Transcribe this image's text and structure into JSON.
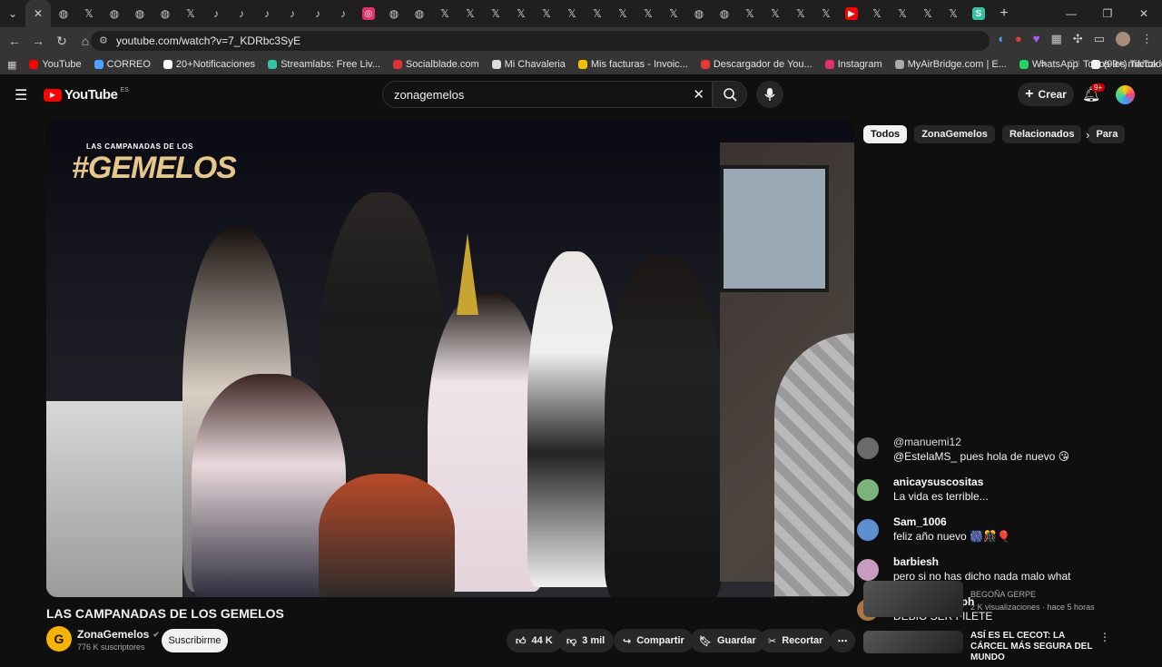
{
  "browser": {
    "url": "youtube.com/watch?v=7_KDRbc3SyE",
    "bookmarks": [
      {
        "label": "YouTube",
        "icon": "youtube-icon",
        "color": "#ff0000"
      },
      {
        "label": "CORREO",
        "icon": "mail-icon",
        "color": "#4aa3ff"
      },
      {
        "label": "20+Notificaciones",
        "icon": "x-icon",
        "color": "#ffffff"
      },
      {
        "label": "Streamlabs: Free Liv...",
        "icon": "streamlabs-icon",
        "color": "#31c3a2"
      },
      {
        "label": "Socialblade.com",
        "icon": "socialblade-icon",
        "color": "#d33"
      },
      {
        "label": "Mi Chavaleria",
        "icon": "chavaleria-icon",
        "color": "#ddd"
      },
      {
        "label": "Mis facturas - Invoic...",
        "icon": "invoice-icon",
        "color": "#f5c000"
      },
      {
        "label": "Descargador de You...",
        "icon": "download-icon",
        "color": "#e53935"
      },
      {
        "label": "Instagram",
        "icon": "instagram-icon",
        "color": "#e1306c"
      },
      {
        "label": "MyAirBridge.com | E...",
        "icon": "cloud-icon",
        "color": "#aaa"
      },
      {
        "label": "WhatsApp",
        "icon": "whatsapp-icon",
        "color": "#25d366"
      },
      {
        "label": "(99+) TikTok de Javi...",
        "icon": "tiktok-icon",
        "color": "#ffffff"
      }
    ],
    "all_bookmarks": "Todos los marcadores"
  },
  "youtube": {
    "logo": "YouTube",
    "region": "ES",
    "search_value": "zonagemelos",
    "create_label": "Crear",
    "notif_count": "9+",
    "chips": [
      "Todos",
      "ZonaGemelos",
      "Relacionados",
      "Para"
    ],
    "video_overlay_title": "LAS CAMPANADAS DE LOS",
    "video_overlay_big": "#GEMELOS",
    "title": "LAS CAMPANADAS DE LOS GEMELOS",
    "channel_name": "ZonaGemelos",
    "subscribers": "776 K suscriptores",
    "subscribe_label": "Suscribirme",
    "likes": "44 K",
    "dislikes": "3 mil",
    "share_label": "Compartir",
    "save_label": "Guardar",
    "clip_label": "Recortar",
    "more_label": "⋯"
  },
  "chat": {
    "messages": [
      {
        "user": "@manuemi12",
        "text": "@EstelaMS_ pues hola de nuevo 😘",
        "avatar_color": "#6a6a6a"
      },
      {
        "user": "anicaysuscositas",
        "text": "La vida es terrible...",
        "avatar_color": "#7bb37b"
      },
      {
        "user": "Sam_1006",
        "text": "feliz año nuevo 🎆🎊🎈",
        "avatar_color": "#5d8fcf"
      },
      {
        "user": "barbiesh",
        "text": "pero si no has dicho nada malo what",
        "avatar_color": "#c89bbf"
      },
      {
        "user": "MartinezNymph",
        "text": "DEBIO SER FILETE",
        "avatar_color": "#aa7744"
      }
    ]
  },
  "recommended": [
    {
      "channel": "BEGOÑA GERPE",
      "meta": "2 K visualizaciones · hace 5 horas"
    },
    {
      "title": "ASÍ ES EL CECOT: LA CÁRCEL MÁS SEGURA DEL MUNDO"
    }
  ]
}
